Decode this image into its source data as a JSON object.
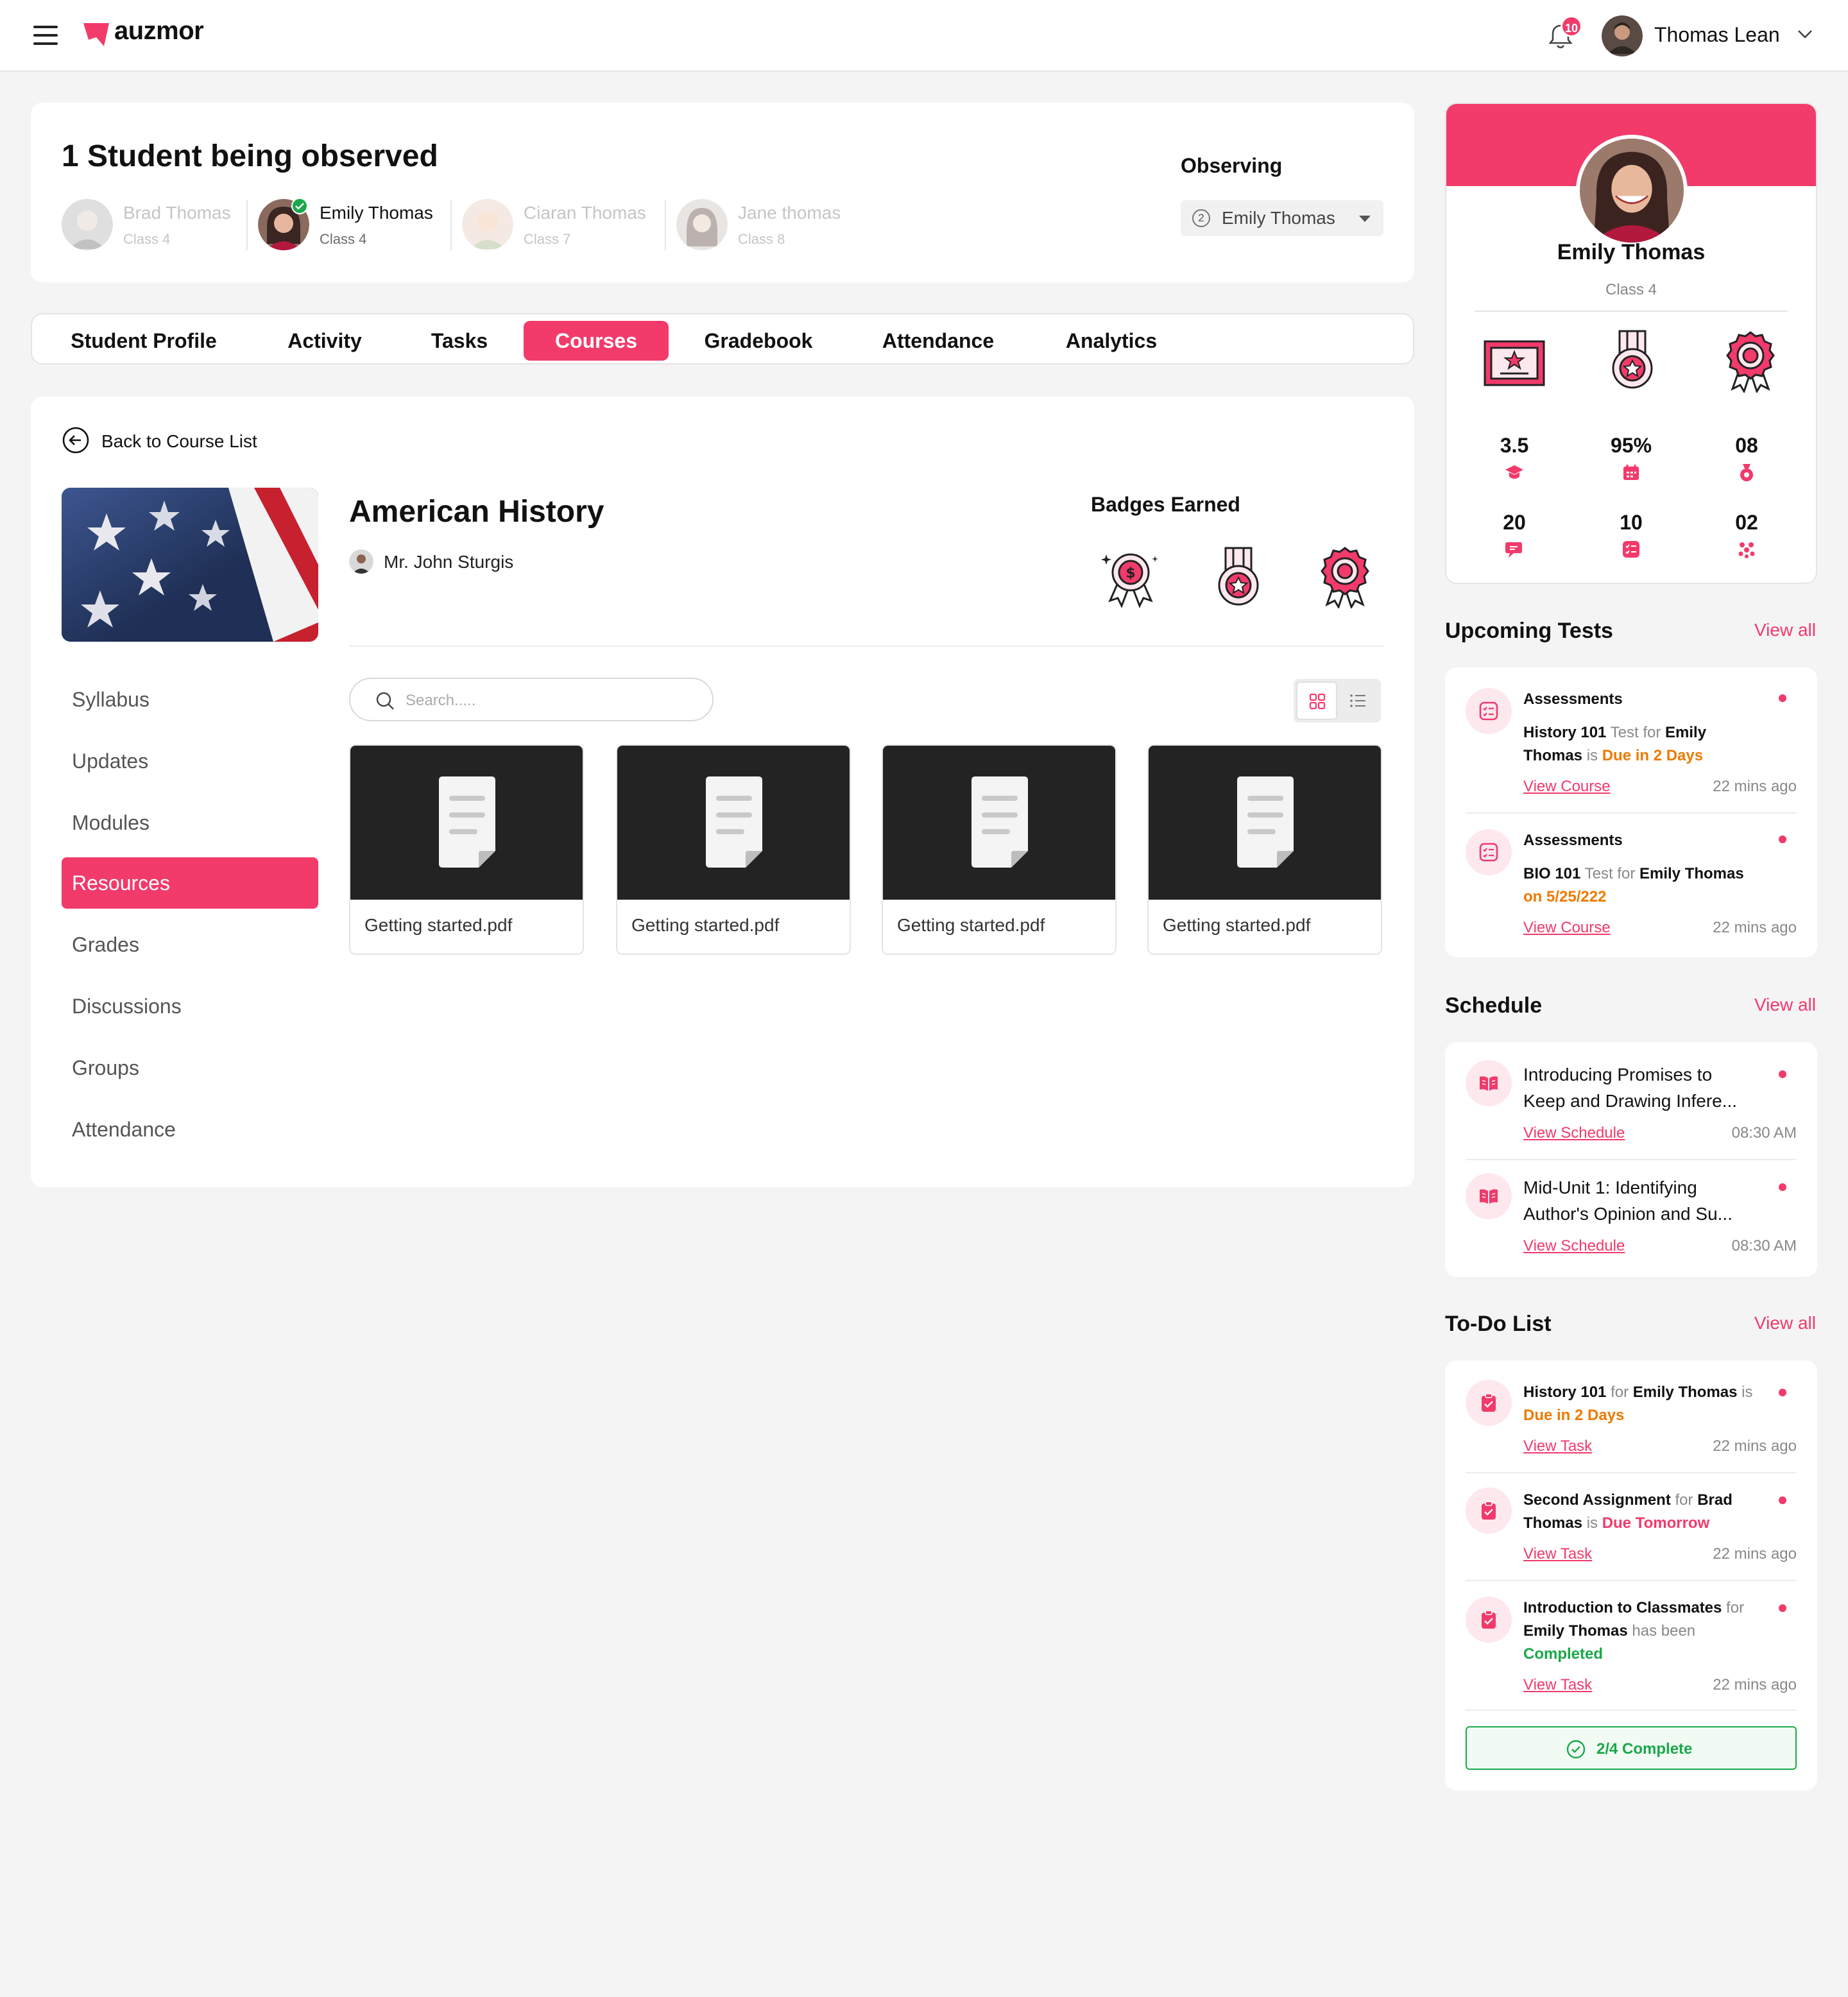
{
  "header": {
    "brand": "auzmor",
    "notification_count": "10",
    "user_name": "Thomas Lean"
  },
  "observed": {
    "title": "1 Student being observed",
    "students": [
      {
        "name": "Brad Thomas",
        "class": "Class 4"
      },
      {
        "name": "Emily Thomas",
        "class": "Class 4"
      },
      {
        "name": "Ciaran Thomas",
        "class": "Class 7"
      },
      {
        "name": "Jane thomas",
        "class": "Class 8"
      }
    ],
    "observing_label": "Observing",
    "observing_count": "2",
    "observing_value": "Emily Thomas"
  },
  "tabs": [
    "Student Profile",
    "Activity",
    "Tasks",
    "Courses",
    "Gradebook",
    "Attendance",
    "Analytics"
  ],
  "course": {
    "back_label": "Back to Course List",
    "title": "American History",
    "teacher": "Mr. John Sturgis",
    "badges_label": "Badges Earned",
    "menu": [
      "Syllabus",
      "Updates",
      "Modules",
      "Resources",
      "Grades",
      "Discussions",
      "Groups",
      "Attendance"
    ],
    "search_placeholder": "Search.....",
    "resources": [
      "Getting started.pdf",
      "Getting started.pdf",
      "Getting started.pdf",
      "Getting started.pdf"
    ]
  },
  "profile": {
    "name": "Emily Thomas",
    "class": "Class 4",
    "stats": [
      "3.5",
      "95%",
      "08",
      "20",
      "10",
      "02"
    ]
  },
  "upcoming_tests": {
    "title": "Upcoming Tests",
    "view_all": "View all",
    "items": [
      {
        "type": "Assessments",
        "course": "History 101",
        "t1": "Test for",
        "student1": "Emily",
        "student2": "Thomas",
        "is": "is",
        "due": "Due in 2 Days",
        "link": "View Course",
        "time": "22 mins ago"
      },
      {
        "type": "Assessments",
        "course": "BIO 101",
        "t1": "Test for",
        "student": "Emily Thomas",
        "due": "on 5/25/222",
        "link": "View Course",
        "time": "22 mins ago"
      }
    ]
  },
  "schedule": {
    "title": "Schedule",
    "view_all": "View all",
    "items": [
      {
        "l1": "Introducing Promises to",
        "l2": "Keep and Drawing Infere...",
        "link": "View Schedule",
        "time": "08:30 AM"
      },
      {
        "l1": "Mid-Unit 1: Identifying",
        "l2": "Author's Opinion and Su...",
        "link": "View Schedule",
        "time": "08:30 AM"
      }
    ]
  },
  "todo": {
    "title": "To-Do List",
    "view_all": "View all",
    "items": [
      {
        "a": "History 101",
        "for": "for",
        "b": "Emily Thomas",
        "is": "is",
        "status": "Due in 2 Days",
        "link": "View Task",
        "time": "22 mins ago"
      },
      {
        "a": "Second Assignment",
        "for": "for",
        "b1": "Brad",
        "b2": "Thomas",
        "is": "is",
        "status": "Due Tomorrow",
        "link": "View Task",
        "time": "22 mins ago"
      },
      {
        "a": "Introduction to Classmates",
        "for": "for",
        "b": "Emily Thomas",
        "is": "has been",
        "status": "Completed",
        "link": "View Task",
        "time": "22 mins ago"
      }
    ],
    "complete_label": "2/4 Complete"
  },
  "colors": {
    "accent": "#f23a6b",
    "success": "#1aa84a",
    "warning": "#ee7a00"
  }
}
